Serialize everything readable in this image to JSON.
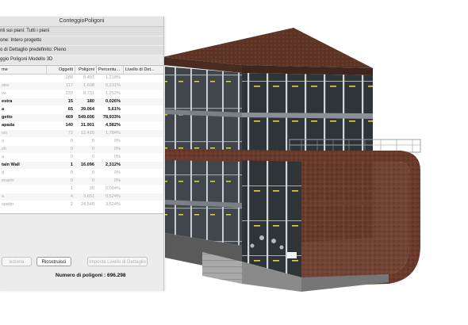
{
  "window": {
    "title": "ConteggioPoligoni"
  },
  "info_rows": [
    "nti sui piani: Tutti i piani",
    "one: Intero progetto",
    "o di Dettaglio predefinito: Pieno",
    "ggio Poligoni Modello 3D"
  ],
  "table": {
    "headers": [
      "me",
      "Oggetti",
      "Poligoni",
      "Percentu...",
      "Livello di Det..."
    ],
    "rows": [
      {
        "name": "",
        "objects": "288",
        "polys": "8.481",
        "percent": "1,218%",
        "style": "dim"
      },
      {
        "name": "stro",
        "objects": "117",
        "polys": "1.608",
        "percent": "0,231%",
        "style": "dim"
      },
      {
        "name": "ve",
        "objects": "233",
        "polys": "8.731",
        "percent": "1,252%",
        "style": "dim"
      },
      {
        "name": "estra",
        "objects": "15",
        "polys": "180",
        "percent": "0,026%",
        "style": "bold"
      },
      {
        "name": "a",
        "objects": "65",
        "polys": "39.064",
        "percent": "5,61%",
        "style": "bold"
      },
      {
        "name": "getto",
        "objects": "469",
        "polys": "549.606",
        "percent": "78,933%",
        "style": "bold"
      },
      {
        "name": "apada",
        "objects": "140",
        "polys": "31.901",
        "percent": "4,582%",
        "style": "bold"
      },
      {
        "name": "sio",
        "objects": "72",
        "polys": "12.420",
        "percent": "1,784%",
        "style": "dim"
      },
      {
        "name": "o",
        "objects": "0",
        "polys": "0",
        "percent": "0%",
        "style": "dim"
      },
      {
        "name": "sh",
        "objects": "0",
        "polys": "0",
        "percent": "0%",
        "style": "dim"
      },
      {
        "name": "a",
        "objects": "0",
        "polys": "0",
        "percent": "0%",
        "style": "dim"
      },
      {
        "name": "tain Wall",
        "objects": "1",
        "polys": "16.096",
        "percent": "2,312%",
        "style": "bold"
      },
      {
        "name": "d",
        "objects": "0",
        "polys": "0",
        "percent": "0%",
        "style": "dim"
      },
      {
        "name": "enario",
        "objects": "0",
        "polys": "0",
        "percent": "0%",
        "style": "dim"
      },
      {
        "name": "",
        "objects": "1",
        "polys": "30",
        "percent": "0,004%",
        "style": "dim"
      },
      {
        "name": "a",
        "objects": "4",
        "polys": "3.651",
        "percent": "0,524%",
        "style": "dim"
      },
      {
        "name": "spetto",
        "objects": "2",
        "polys": "24.540",
        "percent": "3,524%",
        "style": "dim"
      }
    ]
  },
  "buttons": {
    "left": "leziona",
    "rebuild": "Ricostruisci",
    "lod": "Imposta Livello di Dettaglio"
  },
  "total_label": "Numero di poligoni : 696.298",
  "colors": {
    "brick": "#6b3b2a",
    "roof": "#3a2a22",
    "glass": "#3b4046",
    "frame": "#cfd3d6"
  }
}
